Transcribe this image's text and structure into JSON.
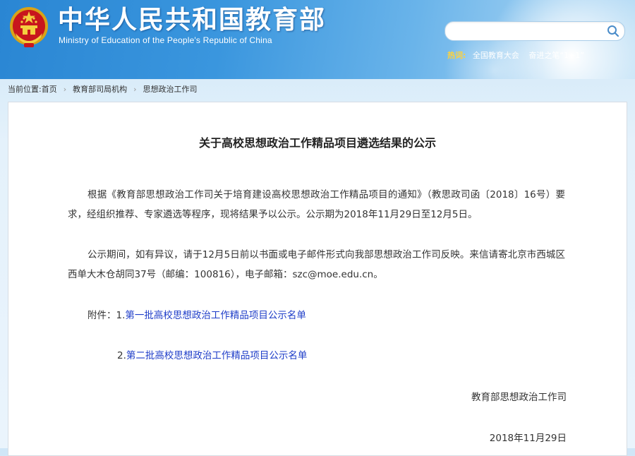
{
  "header": {
    "site_name_cn": "中华人民共和国教育部",
    "site_name_en": "Ministry of Education of the People's Republic of China",
    "search": {
      "placeholder": "",
      "value": ""
    },
    "hot": {
      "label": "热词:",
      "links": [
        "全国教育大会",
        "奋进之笔“1+1”"
      ]
    }
  },
  "breadcrumb": {
    "prefix": "当前位置:",
    "items": [
      "首页",
      "教育部司局机构",
      "思想政治工作司"
    ],
    "separator": "›"
  },
  "article": {
    "title": "关于高校思想政治工作精品项目遴选结果的公示",
    "paragraphs": [
      "根据《教育部思想政治工作司关于培育建设高校思想政治工作精品项目的通知》（教思政司函〔2018〕16号）要求，经组织推荐、专家遴选等程序，现将结果予以公示。公示期为2018年11月29日至12月5日。",
      "公示期间，如有异议，请于12月5日前以书面或电子邮件形式向我部思想政治工作司反映。来信请寄北京市西城区西单大木仓胡同37号（邮编：100816），电子邮箱：szc@moe.edu.cn。"
    ],
    "attachments": {
      "label": "附件：",
      "items": [
        {
          "num": "1.",
          "text": "第一批高校思想政治工作精品项目公示名单"
        },
        {
          "num": "2.",
          "text": "第二批高校思想政治工作精品项目公示名单"
        }
      ]
    },
    "signature": "教育部思想政治工作司",
    "date": "2018年11月29日"
  },
  "colors": {
    "header_blue": "#2a86d3",
    "link_blue": "#1e3dc8",
    "hot_label": "#ffd23a"
  },
  "icons": [
    "national-emblem-icon",
    "search-icon",
    "chevron-right-icon"
  ]
}
